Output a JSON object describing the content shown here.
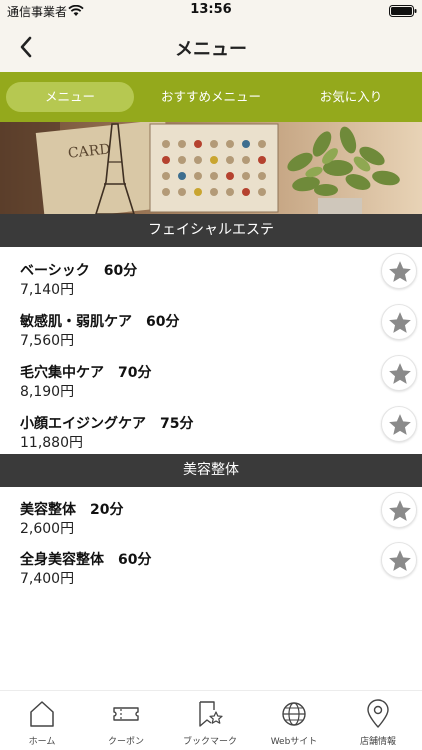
{
  "status": {
    "carrier": "通信事業者",
    "time": "13:56"
  },
  "header": {
    "title": "メニュー"
  },
  "tabs": [
    {
      "label": "メニュー",
      "active": true
    },
    {
      "label": "おすすめメニュー",
      "active": false
    },
    {
      "label": "お気に入り",
      "active": false
    }
  ],
  "sections": [
    {
      "title": "フェイシャルエステ",
      "items": [
        {
          "name": "ベーシック　60分",
          "price": "7,140円"
        },
        {
          "name": "敏感肌・弱肌ケア　60分",
          "price": "7,560円"
        },
        {
          "name": "毛穴集中ケア　70分",
          "price": "8,190円"
        },
        {
          "name": "小顔エイジングケア　75分",
          "price": "11,880円"
        }
      ]
    },
    {
      "title": "美容整体",
      "items": [
        {
          "name": "美容整体　20分",
          "price": "2,600円"
        },
        {
          "name": "全身美容整体　60分",
          "price": "7,400円"
        }
      ]
    }
  ],
  "bottom_nav": [
    {
      "label": "ホーム",
      "icon": "home-icon"
    },
    {
      "label": "クーポン",
      "icon": "coupon-icon"
    },
    {
      "label": "ブックマーク",
      "icon": "bookmark-icon"
    },
    {
      "label": "Webサイト",
      "icon": "globe-icon"
    },
    {
      "label": "店舗情報",
      "icon": "location-pin-icon"
    }
  ],
  "colors": {
    "tab_bar": "#94a91c",
    "tab_active": "#b6c851",
    "section_header": "#3a3a3a",
    "header_bg": "#f7f4ee",
    "star": "#8a8a8a"
  }
}
